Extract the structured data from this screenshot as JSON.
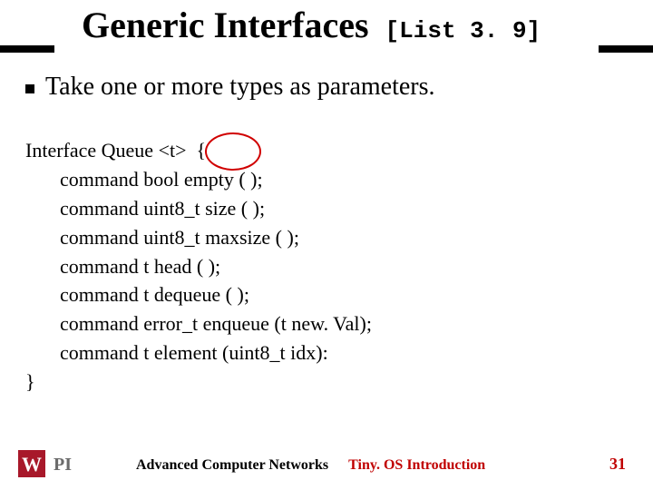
{
  "title_main": "Generic Interfaces",
  "title_sub": "[List 3. 9]",
  "bullet_text": "Take one or more types as parameters.",
  "code": {
    "l0": "Interface Queue <t>  {",
    "l1": "command bool empty ( );",
    "l2": "command uint8_t size ( );",
    "l3": "command uint8_t maxsize ( );",
    "l4": "command t head ( );",
    "l5": "command t dequeue ( );",
    "l6": "command error_t enqueue (t new. Val);",
    "l7": "command t element (uint8_t idx):",
    "l8": "}"
  },
  "footer_course": "Advanced Computer Networks",
  "footer_topic": "Tiny. OS Introduction",
  "page_number": "31",
  "logo_text_top": "W",
  "logo_text_bottom": "PI"
}
